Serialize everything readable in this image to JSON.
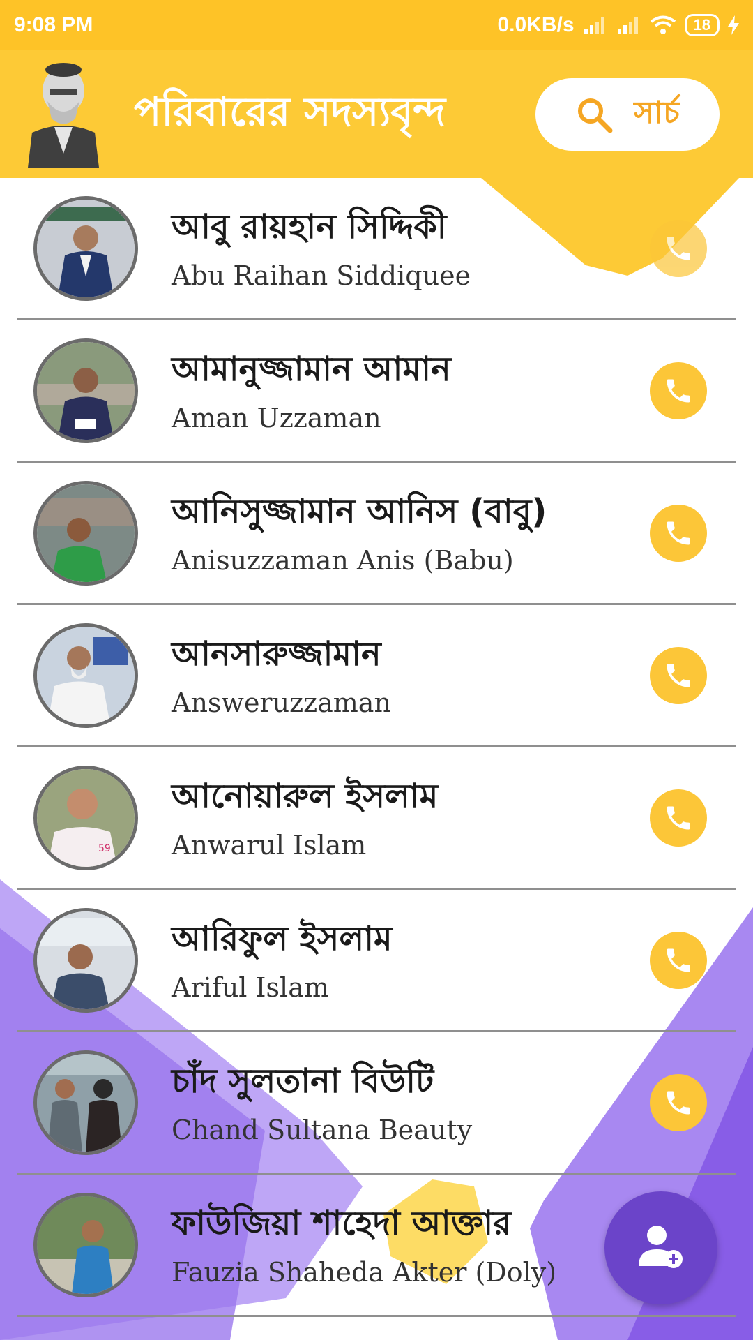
{
  "status_bar": {
    "time": "9:08 PM",
    "network_speed": "0.0KB/s",
    "battery": "18"
  },
  "header": {
    "title": "পরিবারের সদস্যবৃন্দ",
    "search_label": "সার্চ"
  },
  "contacts": [
    {
      "name_bn": "আবু রায়হান সিদ্দিকী",
      "name_en": "Abu Raihan Siddiquee"
    },
    {
      "name_bn": "আমানুজ্জামান আমান",
      "name_en": "Aman Uzzaman"
    },
    {
      "name_bn": "আনিসুজ্জামান আনিস (বাবু)",
      "name_en": "Anisuzzaman Anis (Babu)"
    },
    {
      "name_bn": "আনসারুজ্জামান",
      "name_en": "Answeruzzaman"
    },
    {
      "name_bn": "আনোয়ারুল ইসলাম",
      "name_en": "Anwarul Islam"
    },
    {
      "name_bn": "আরিফুল ইসলাম",
      "name_en": "Ariful Islam"
    },
    {
      "name_bn": "চাঁদ সুলতানা বিউটি",
      "name_en": "Chand Sultana Beauty"
    },
    {
      "name_bn": "ফাউজিয়া শাহেদা আক্তার",
      "name_en": "Fauzia Shaheda Akter (Doly)"
    }
  ],
  "colors": {
    "accent_yellow": "#fdca36",
    "accent_purple": "#6b44c9"
  },
  "icons": {
    "search": "search-icon",
    "call": "phone-icon",
    "add_member": "add-user-icon"
  }
}
